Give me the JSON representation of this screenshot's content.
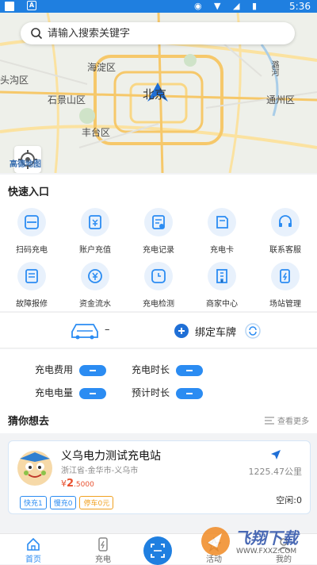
{
  "status_bar": {
    "time": "5:36",
    "icons": "◉ ▼ ◢ ▮"
  },
  "search": {
    "placeholder": "请输入搜索关键字"
  },
  "map": {
    "labels": [
      "海淀区",
      "北京",
      "石景山区",
      "丰台区",
      "通州区",
      "头沟区",
      "潞河"
    ],
    "logo": "高德地图"
  },
  "quick_entry": {
    "title": "快速入口",
    "items": [
      {
        "label": "扫码充电",
        "icon": "scan-icon"
      },
      {
        "label": "账户充值",
        "icon": "recharge-icon"
      },
      {
        "label": "充电记录",
        "icon": "record-icon"
      },
      {
        "label": "充电卡",
        "icon": "card-icon"
      },
      {
        "label": "联系客服",
        "icon": "headset-icon"
      },
      {
        "label": "故障报修",
        "icon": "repair-icon"
      },
      {
        "label": "资金流水",
        "icon": "yuan-icon"
      },
      {
        "label": "充电检测",
        "icon": "clock-icon"
      },
      {
        "label": "商家中心",
        "icon": "building-icon"
      },
      {
        "label": "场站管理",
        "icon": "station-icon"
      }
    ]
  },
  "car": {
    "plate": "–",
    "bind_label": "绑定车牌"
  },
  "stats": {
    "fee_label": "充电费用",
    "duration_label": "充电时长",
    "energy_label": "充电电量",
    "estimate_label": "预计时长"
  },
  "guess": {
    "title": "猜你想去",
    "more": "查看更多"
  },
  "station": {
    "name": "义乌电力测试充电站",
    "address": "浙江省-金华市-义乌市",
    "price_symbol": "¥",
    "price_main": "2",
    "price_decimal": ".5000",
    "distance": "1225.47公里",
    "tags": [
      "快充1",
      "慢充0",
      "停车0元"
    ],
    "idle": "空闲:0"
  },
  "tabbar": {
    "home": "首页",
    "charge": "充电",
    "activity": "活动",
    "mine": "我的"
  },
  "watermark": {
    "line1": "飞翔下载",
    "line2": "WWW.FXXZ.COM"
  },
  "colors": {
    "accent": "#2b8cf2",
    "price": "#e8502e",
    "statusbar": "#1f7fe0"
  }
}
